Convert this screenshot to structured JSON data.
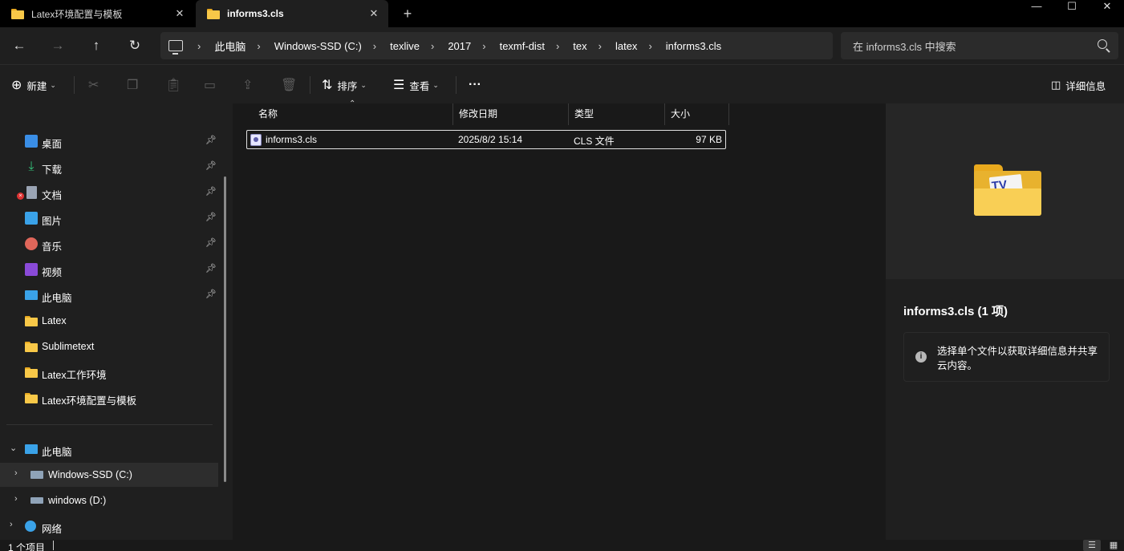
{
  "tabs": [
    {
      "label": "Latex环境配置与模板",
      "close": "✕"
    },
    {
      "label": "informs3.cls",
      "close": "✕"
    }
  ],
  "new_tab": "+",
  "window_controls": {
    "minimize": "—",
    "maximize": "☐",
    "close": "✕"
  },
  "nav": {
    "back": "←",
    "forward": "→",
    "up": "↑",
    "refresh": "↻"
  },
  "breadcrumb": [
    "此电脑",
    "Windows-SSD (C:)",
    "texlive",
    "2017",
    "texmf-dist",
    "tex",
    "latex",
    "informs3.cls"
  ],
  "breadcrumb_separator": "›",
  "search": {
    "placeholder": "在 informs3.cls 中搜索"
  },
  "toolbar": {
    "new_label": "新建",
    "sort_label": "排序",
    "view_label": "查看",
    "more_label": "···",
    "details_label": "详细信息"
  },
  "sidebar": {
    "quick_access": [
      {
        "label": "桌面",
        "icon": "desktop-icon",
        "color": "#3a8ee6"
      },
      {
        "label": "下载",
        "icon": "download-icon",
        "color": "#35c07a"
      },
      {
        "label": "文档",
        "icon": "document-icon",
        "color": "#9aa4b4"
      },
      {
        "label": "图片",
        "icon": "pictures-icon",
        "color": "#3aa2e8"
      },
      {
        "label": "音乐",
        "icon": "music-icon",
        "color": "#e0665a"
      },
      {
        "label": "视频",
        "icon": "video-icon",
        "color": "#8a4ad8"
      },
      {
        "label": "此电脑",
        "icon": "computer-icon",
        "color": "#3aa2e8"
      },
      {
        "label": "Latex",
        "icon": "folder-icon",
        "color": "#f8c848"
      },
      {
        "label": "Sublimetext",
        "icon": "folder-icon",
        "color": "#f8c848"
      },
      {
        "label": "Latex工作环境",
        "icon": "folder-icon",
        "color": "#f8c848"
      },
      {
        "label": "Latex环境配置与模板",
        "icon": "folder-icon",
        "color": "#f8c848"
      }
    ],
    "tree": [
      {
        "label": "此电脑",
        "expand": "⌄"
      },
      {
        "label": "Windows-SSD (C:)",
        "expand": "›"
      },
      {
        "label": "windows (D:)",
        "expand": "›"
      },
      {
        "label": "网络",
        "expand": "›"
      }
    ],
    "pin": "📌"
  },
  "columns": {
    "name": "名称",
    "modified": "修改日期",
    "type": "类型",
    "size": "大小",
    "sort_caret": "⌃"
  },
  "files": [
    {
      "name": "informs3.cls",
      "modified": "2025/8/2 15:14",
      "type": "CLS 文件",
      "size": "97 KB"
    }
  ],
  "details": {
    "title": "informs3.cls (1 项)",
    "info_icon": "i",
    "info_text": "选择单个文件以获取详细信息并共享云内容。",
    "preview_mark": "TV"
  },
  "status": {
    "count": "1 个项目"
  }
}
